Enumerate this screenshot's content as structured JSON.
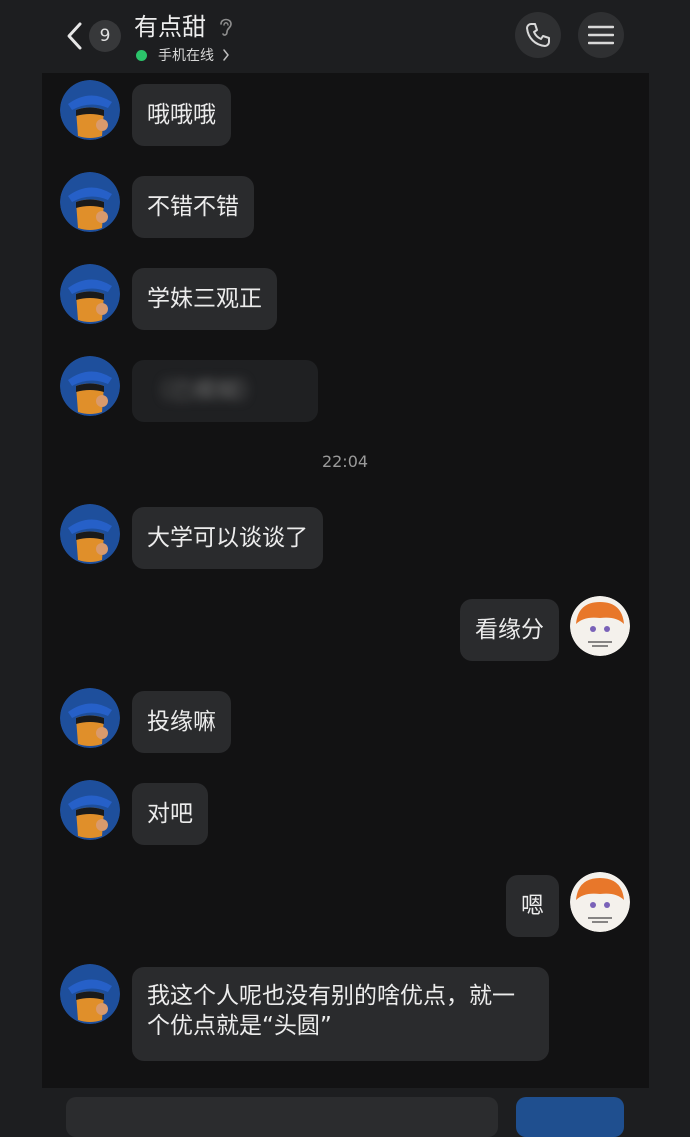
{
  "header": {
    "unread_count": "9",
    "contact_name": "有点甜",
    "status_text": "手机在线",
    "icons": {
      "back": "chevron-left-icon",
      "ear": "ear-icon",
      "status_chevron": "chevron-right-icon",
      "phone": "phone-icon",
      "menu": "hamburger-menu-icon"
    }
  },
  "colors": {
    "online": "#2bc36a",
    "bubble": "#2a2b2d",
    "background": "#121213",
    "send_button": "#1f4f8f"
  },
  "timestamp": "22:04",
  "messages": [
    {
      "side": "left",
      "text": "哦哦哦"
    },
    {
      "side": "left",
      "text": "不错不错"
    },
    {
      "side": "left",
      "text": "学妹三观正"
    },
    {
      "side": "left",
      "text": "（已模糊）",
      "blurred": true
    },
    {
      "side": "left",
      "text": "大学可以谈谈了"
    },
    {
      "side": "right",
      "text": "看缘分"
    },
    {
      "side": "left",
      "text": "投缘嘛"
    },
    {
      "side": "left",
      "text": "对吧"
    },
    {
      "side": "right",
      "text": "嗯"
    },
    {
      "side": "left",
      "text": "我这个人呢也没有别的啥优点，就一个优点就是“头圆”"
    }
  ]
}
